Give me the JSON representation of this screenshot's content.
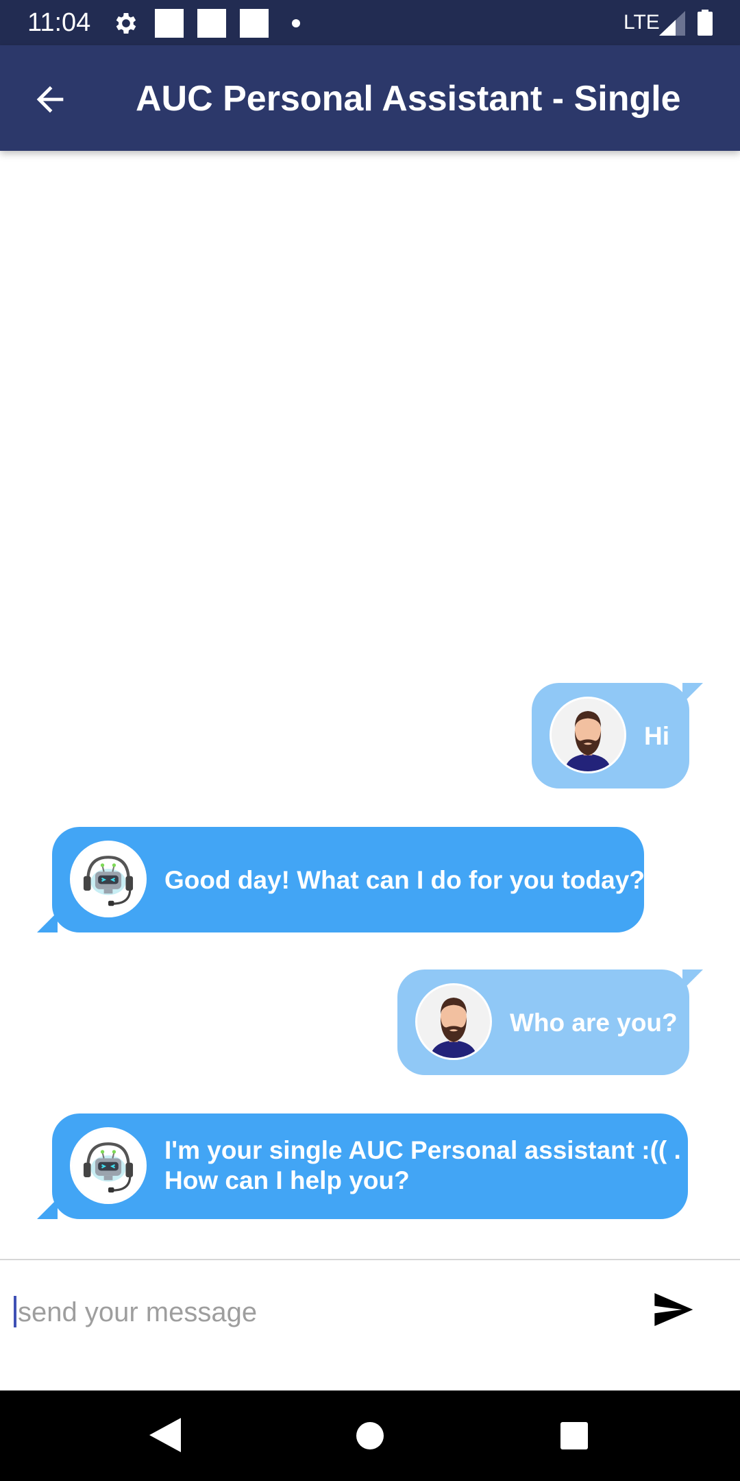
{
  "status_bar": {
    "time": "11:04",
    "network": "LTE"
  },
  "app_bar": {
    "title": "AUC Personal Assistant - Single"
  },
  "messages": [
    {
      "sender": "user",
      "avatar": "bearded-man-avatar",
      "text": "Hi"
    },
    {
      "sender": "bot",
      "avatar": "robot-headset-avatar",
      "text": "Good day! What can I do for you today?"
    },
    {
      "sender": "user",
      "avatar": "bearded-man-avatar",
      "text": "Who are you?"
    },
    {
      "sender": "bot",
      "avatar": "robot-headset-avatar",
      "lines": [
        "I'm your single AUC Personal assistant :(( .",
        "How can I help you?"
      ]
    }
  ],
  "input": {
    "value": "",
    "placeholder": "send your message"
  },
  "colors": {
    "status_bar": "#222c52",
    "app_bar": "#2c386a",
    "user_bubble": "#90c8f6",
    "bot_bubble": "#42a5f5",
    "nav_bar": "#000000"
  },
  "icons": {
    "back": "arrow-left-icon",
    "send": "send-icon",
    "nav_back": "triangle-back-icon",
    "nav_home": "circle-home-icon",
    "nav_recent": "square-recents-icon"
  }
}
